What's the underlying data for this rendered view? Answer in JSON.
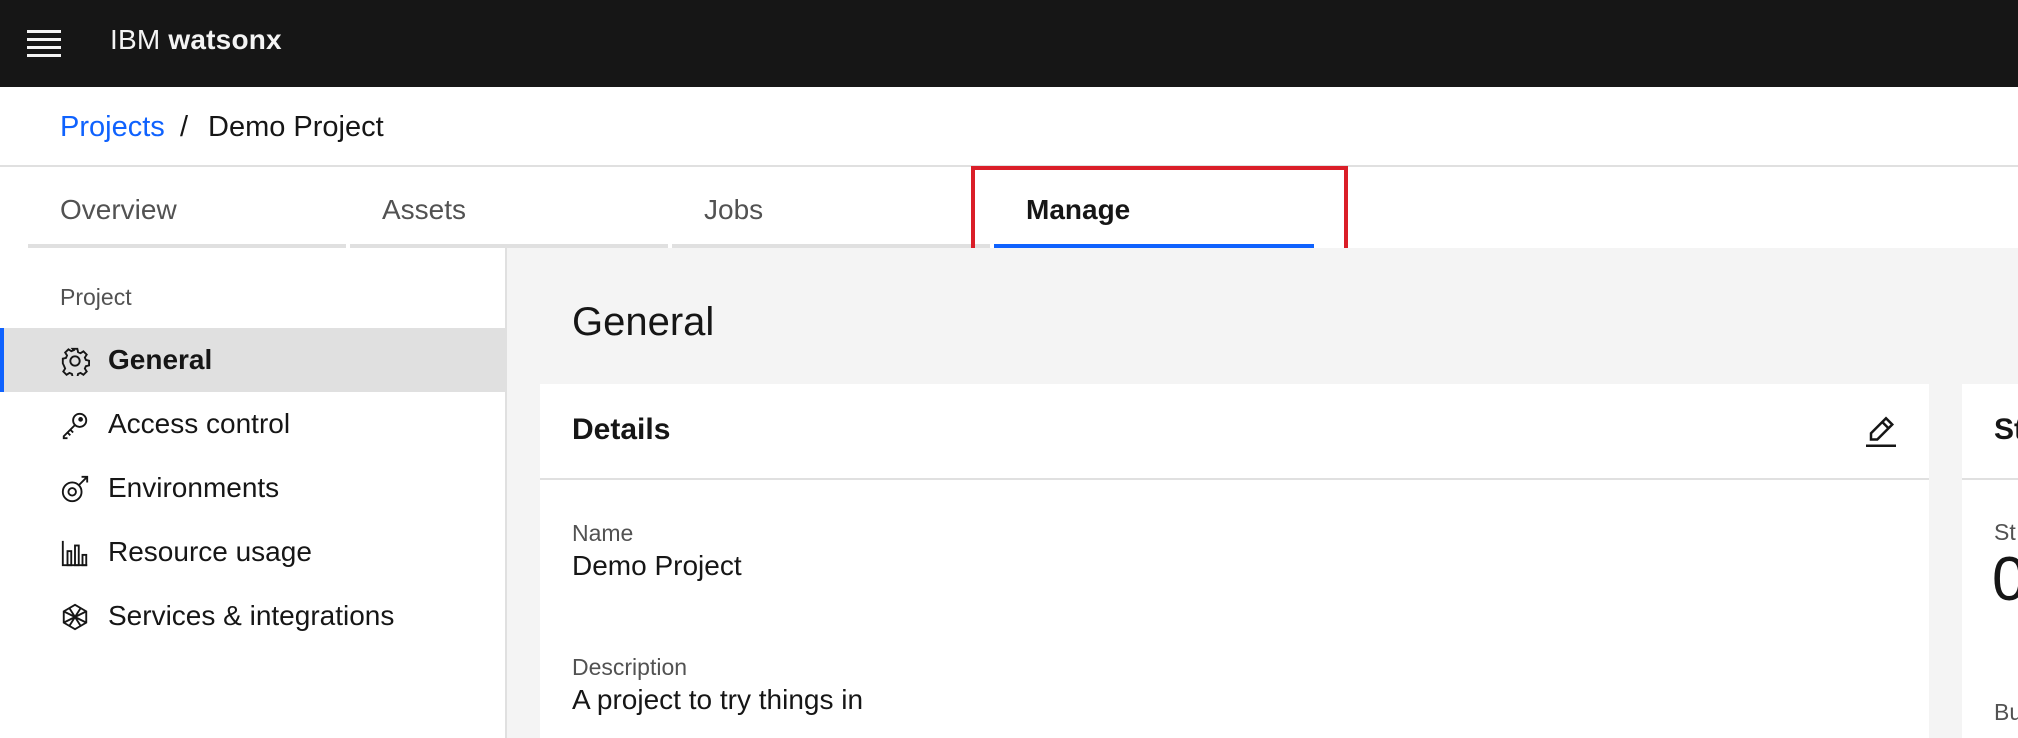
{
  "header": {
    "brand_plain": "IBM",
    "brand_bold": "watsonx"
  },
  "breadcrumb": {
    "parent": "Projects",
    "separator": "/",
    "current": "Demo Project"
  },
  "tabs": [
    {
      "label": "Overview",
      "active": false
    },
    {
      "label": "Assets",
      "active": false
    },
    {
      "label": "Jobs",
      "active": false
    },
    {
      "label": "Manage",
      "active": true
    }
  ],
  "sidenav": {
    "heading": "Project",
    "items": [
      {
        "label": "General",
        "icon": "gear-icon",
        "active": true
      },
      {
        "label": "Access control",
        "icon": "key-icon",
        "active": false
      },
      {
        "label": "Environments",
        "icon": "environment-icon",
        "active": false
      },
      {
        "label": "Resource usage",
        "icon": "bar-chart-icon",
        "active": false
      },
      {
        "label": "Services & integrations",
        "icon": "integrations-icon",
        "active": false
      }
    ]
  },
  "main": {
    "title": "General",
    "details_card": {
      "title": "Details",
      "name_label": "Name",
      "name_value": "Demo Project",
      "description_label": "Description",
      "description_value": "A project to try things in"
    },
    "storage_card": {
      "title_partial": "St",
      "label_partial": "St",
      "value_partial": "0",
      "label2_partial": "Bu"
    }
  },
  "colors": {
    "accent": "#0f62fe",
    "header_bg": "#161616",
    "highlight": "#da1e28",
    "content_bg": "#f4f4f4"
  }
}
